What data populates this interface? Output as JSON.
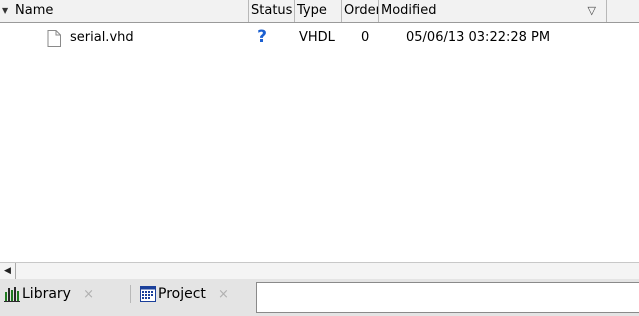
{
  "columns": {
    "name": "Name",
    "status": "Status",
    "type": "Type",
    "order": "Order",
    "modified": "Modified"
  },
  "rows": [
    {
      "name": "serial.vhd",
      "status": "?",
      "type": "VHDL",
      "order": "0",
      "modified": "05/06/13 03:22:28 PM"
    }
  ],
  "tabs": [
    {
      "label": "Library",
      "icon": "library-icon",
      "close": "×"
    },
    {
      "label": "Project",
      "icon": "project-icon",
      "close": "×"
    }
  ],
  "icons": {
    "expand": "tri-down-icon",
    "sort": "sort-down-icon",
    "scroll_left": "scroll-left-arrow-icon",
    "file": "file-icon",
    "status_unknown": "question-icon"
  },
  "colors": {
    "status_question": "#1a5fd1",
    "library_icon": "#1f7a1f"
  }
}
